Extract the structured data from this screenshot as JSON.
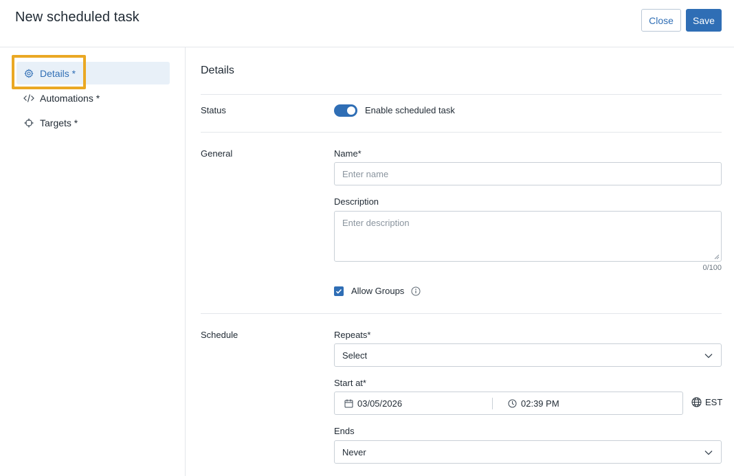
{
  "header": {
    "title": "New scheduled task",
    "close_label": "Close",
    "save_label": "Save"
  },
  "sidebar": {
    "items": [
      {
        "label": "Details *",
        "icon": "gear-icon",
        "active": true
      },
      {
        "label": "Automations *",
        "icon": "code-icon",
        "active": false
      },
      {
        "label": "Targets *",
        "icon": "crosshair-icon",
        "active": false
      }
    ]
  },
  "main": {
    "section_title": "Details",
    "status": {
      "label": "Status",
      "toggle_label": "Enable scheduled task",
      "enabled": true
    },
    "general": {
      "label": "General",
      "name_label": "Name*",
      "name_placeholder": "Enter name",
      "description_label": "Description",
      "description_placeholder": "Enter description",
      "description_counter": "0/100",
      "allow_groups_label": "Allow Groups",
      "allow_groups_checked": true
    },
    "schedule": {
      "label": "Schedule",
      "repeats_label": "Repeats*",
      "repeats_value": "Select",
      "start_label": "Start at*",
      "start_date": "03/05/2026",
      "start_time": "02:39 PM",
      "timezone": "EST",
      "ends_label": "Ends",
      "ends_value": "Never"
    }
  },
  "colors": {
    "accent": "#2f6eb5",
    "highlight": "#eaa824",
    "active_bg": "#e8f0f8"
  }
}
